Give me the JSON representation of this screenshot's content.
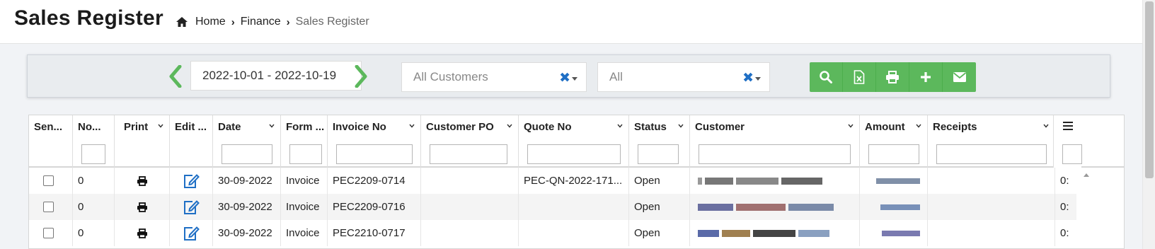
{
  "page": {
    "title": "Sales Register"
  },
  "breadcrumb": {
    "home": "Home",
    "finance": "Finance",
    "current": "Sales Register"
  },
  "filters": {
    "date_range": "2022-10-01 - 2022-10-19",
    "customer": "All Customers",
    "status": "All"
  },
  "columns": [
    {
      "label": "Sen..."
    },
    {
      "label": "No..."
    },
    {
      "label": "Print"
    },
    {
      "label": "Edit ..."
    },
    {
      "label": "Date"
    },
    {
      "label": "Form ..."
    },
    {
      "label": "Invoice No"
    },
    {
      "label": "Customer PO"
    },
    {
      "label": "Quote No"
    },
    {
      "label": "Status"
    },
    {
      "label": "Customer"
    },
    {
      "label": "Amount"
    },
    {
      "label": "Receipts"
    }
  ],
  "rows": [
    {
      "no": "0",
      "date": "30-09-2022",
      "form": "Invoice",
      "invoice": "PEC2209-0714",
      "po": "",
      "quote": "PEC-QN-2022-171...",
      "status": "Open",
      "tail": "0:"
    },
    {
      "no": "0",
      "date": "30-09-2022",
      "form": "Invoice",
      "invoice": "PEC2209-0716",
      "po": "",
      "quote": "",
      "status": "Open",
      "tail": "0:"
    },
    {
      "no": "0",
      "date": "30-09-2022",
      "form": "Invoice",
      "invoice": "PEC2210-0717",
      "po": "",
      "quote": "",
      "status": "Open",
      "tail": "0:"
    }
  ],
  "colors": {
    "accent_green": "#5cb85c",
    "icon_blue": "#1f6fc5"
  },
  "icons": [
    "home-icon",
    "chevron-left-icon",
    "chevron-right-icon",
    "clear-icon",
    "search-icon",
    "excel-icon",
    "print-icon",
    "plus-icon",
    "email-icon",
    "edit-icon",
    "columns-menu-icon"
  ]
}
